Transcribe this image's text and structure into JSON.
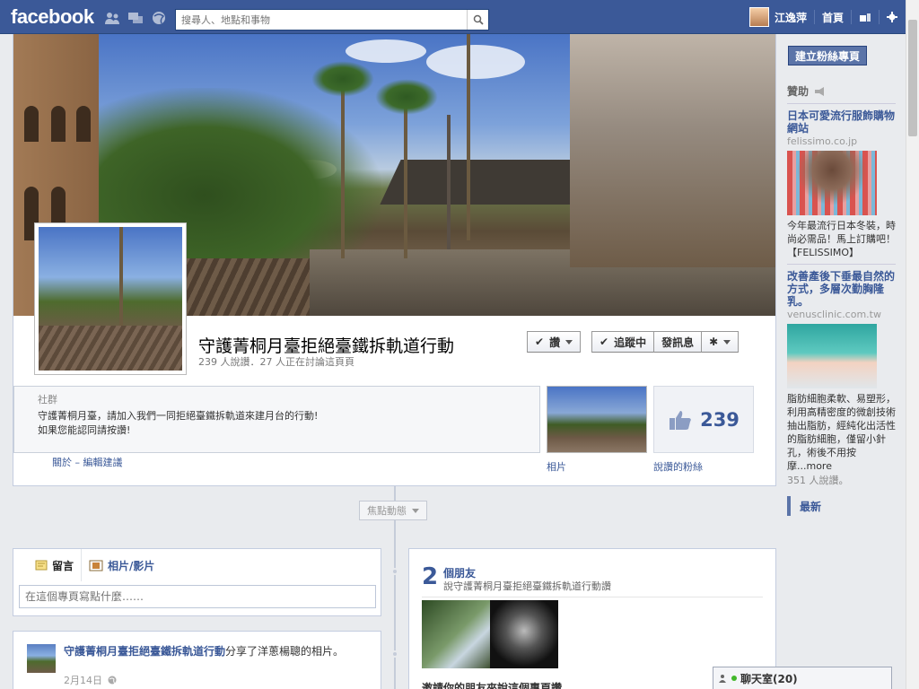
{
  "topbar": {
    "logo": "facebook",
    "search_placeholder": "搜尋人、地點和事物",
    "user_name": "江逸萍",
    "home_label": "首頁",
    "icons": [
      "friend-requests-icon",
      "messages-icon",
      "notifications-icon",
      "search-icon",
      "privacy-icon",
      "settings-icon"
    ]
  },
  "page": {
    "name": "守護菁桐月臺拒絕臺鐵拆軌道行動",
    "subtitle": "239 人說讚．27 人正在討論這頁頁",
    "like_button": "讚",
    "follow_button": "追蹤中",
    "message_button": "發訊息",
    "about": {
      "category": "社群",
      "description_line1": "守護菁桐月臺，請加入我們一同拒絕臺鐵拆軌道來建月台的行動!",
      "description_line2": "如果您能認同請按讚!",
      "about_label": "關於",
      "edit_label": "– 編輯建議"
    },
    "photos_label": "相片",
    "likes_count": "239",
    "likes_label": "說讚的粉絲"
  },
  "timeline": {
    "focus_label": "焦點動態",
    "composer": {
      "tab_post": "留言",
      "tab_photo": "相片/影片",
      "placeholder": "在這個專頁寫點什麼……"
    },
    "story": {
      "actor": "守護菁桐月臺拒絕臺鐵拆軌道行動",
      "text": "分享了洋蔥楊聰的相片。",
      "date": "2月14日"
    },
    "friends": {
      "count": "2",
      "heading": "個朋友",
      "subtitle": "說守護菁桐月臺拒絕臺鐵拆軌道行動讚",
      "invite": "邀請你的朋友來說這個專頁讚"
    }
  },
  "rail": {
    "create_page": "建立粉絲專頁",
    "sponsored_label": "贊助",
    "ads": [
      {
        "title": "日本可愛流行服飾購物網站",
        "url": "felissimo.co.jp",
        "body": "今年最流行日本冬裝，時尚必需品！馬上訂購吧！【FELISSIMO】",
        "likes": ""
      },
      {
        "title": "改善產後下垂最自然的方式，多層次勤胸隆乳。",
        "url": "venusclinic.com.tw",
        "body": "脂肪細胞柔軟、易塑形，利用高精密度的微創技術抽出脂肪，經純化出活性的脂肪細胞，僅留小針孔，術後不用按摩...more",
        "likes": "351 人說讚。"
      }
    ],
    "recent_label": "最新"
  },
  "chat": {
    "label": "聊天室(20)"
  },
  "colors": {
    "brand": "#3b5998",
    "background": "#e9ebee"
  }
}
